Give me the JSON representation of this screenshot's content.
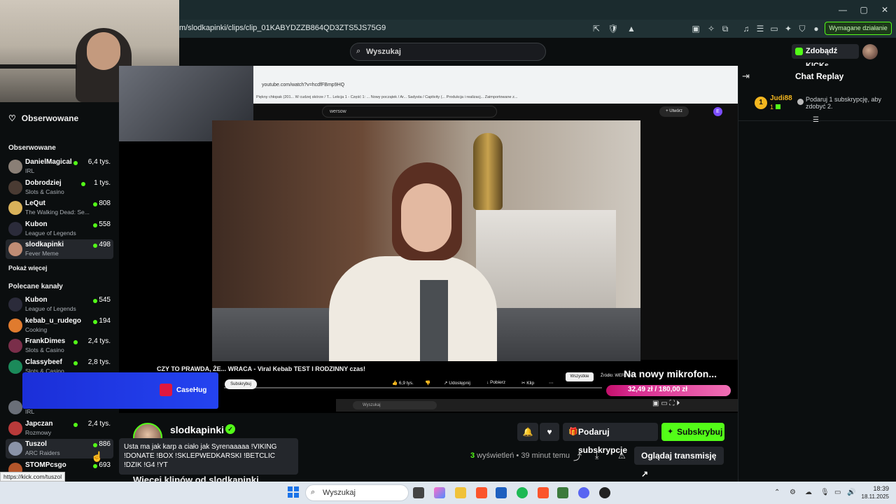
{
  "browser": {
    "url": "m/slodkapinki/clips/clip_01KABYDZZB864QD3ZTS5JS75G9",
    "extension_action": "Wymagane działanie"
  },
  "header": {
    "search_placeholder": "Wyszukaj",
    "kicks_button": "Zdobądź KICKs"
  },
  "sidebar": {
    "nav_followed": "Obserwowane",
    "followed_heading": "Obserwowane",
    "followed": [
      {
        "name": "DanielMagical",
        "category": "IRL",
        "viewers": "6,4 tys.",
        "color": "#8a7f76"
      },
      {
        "name": "Dobrodziej",
        "category": "Slots & Casino",
        "viewers": "1 tys.",
        "color": "#4a3b33"
      },
      {
        "name": "LeQut",
        "category": "The Walking Dead: Se...",
        "viewers": "808",
        "color": "#d9b25a"
      },
      {
        "name": "Kubon",
        "category": "League of Legends",
        "viewers": "558",
        "color": "#2b2b3a"
      },
      {
        "name": "slodkapinki",
        "category": "Fever Meme",
        "viewers": "498",
        "color": "#c08c74"
      }
    ],
    "show_more": "Pokaż więcej",
    "recommended_heading": "Polecane kanały",
    "recommended": [
      {
        "name": "Kubon",
        "category": "League of Legends",
        "viewers": "545",
        "color": "#2b2b3a"
      },
      {
        "name": "kebab_u_rudego",
        "category": "Cooking",
        "viewers": "194",
        "color": "#e07b2e"
      },
      {
        "name": "FrankDimes",
        "category": "Slots & Casino",
        "viewers": "2,4 tys.",
        "color": "#7a2e4a"
      },
      {
        "name": "Classybeef",
        "category": "Slots & Casino",
        "viewers": "2,8 tys.",
        "color": "#1b8a5a"
      }
    ],
    "recommended_lower": [
      {
        "name": "",
        "category": "IRL",
        "viewers": "",
        "color": "#6a6f78"
      },
      {
        "name": "Japczan",
        "category": "Rozmowy",
        "viewers": "2,4 tys.",
        "color": "#b83a3a"
      },
      {
        "name": "Tuszol",
        "category": "ARC Raiders",
        "viewers": "886",
        "color": "#8a93a8"
      },
      {
        "name": "STOMPcsgo",
        "category": "",
        "viewers": "693",
        "color": "#b3552a"
      }
    ]
  },
  "video": {
    "yt_url": "youtube.com/watch?v=hcdfFBmp9HQ",
    "yt_bookmarks": "Piękny chłopak (201...   W cudzej skórze / T...   Lekcja 1 - Część 1: ...   Nowy początek / Ar...   Sadysta / Captivity (...   Produkcja i realizacj...   Zaimportowane z...",
    "yt_search": "wersow",
    "yt_create": "+ Utwórz",
    "yt_title": "CZY TO PRAWDA, ŻE... WRACA - Viral Kebab TEST I RODZINNY czas!",
    "yt_subscribe": "Subskrybuj",
    "yt_likes": "6,9 tys.",
    "yt_share": "Udostępnij",
    "yt_download": "Pobierz",
    "yt_clip": "Klip",
    "yt_all": "Wszystkie",
    "yt_source": "Źródło: WERSOW",
    "overlay_text": "Na nowy mikrofon...",
    "goal_text": "32,49 zł / 180,00 zł",
    "goal_progress": 0.18,
    "sponsor": "CaseHug",
    "inner_search": "Wyszukaj"
  },
  "chat": {
    "title": "Chat Replay",
    "user": "Judi88",
    "user_badge": "1",
    "user_count": "1",
    "message": "Podaruj 1 subskrypcję, aby zdobyć 2."
  },
  "channel": {
    "name": "slodkapinki",
    "gift_button": "Podaruj subskrypcje",
    "follow_button": "Subskrybuj",
    "views_count": "3",
    "views_label": " wyświetleń",
    "time_ago": " • 39 minut temu",
    "watch_button": "Oglądaj transmisję",
    "more_clips": "Więcej klipów od slodkapinki",
    "tooltip": "Usta ma jak karp a ciało jak Syrenaaaaa !VIKING !DONATE !BOX !SKLEPWEDKARSKI !BETCLIC !DZIK !G4 !YT",
    "status_url": "https://kick.com/tuszol"
  },
  "taskbar": {
    "search": "Wyszukaj",
    "time": "18:39",
    "date": "18.11.2025"
  }
}
